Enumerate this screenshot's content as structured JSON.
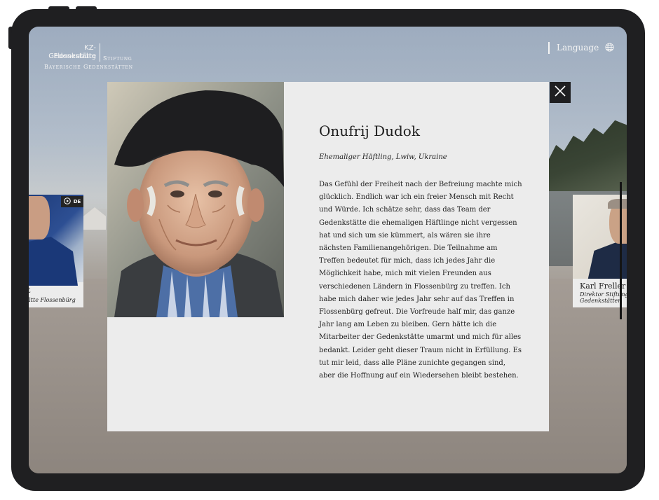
{
  "logo": {
    "line1": "KZ-Gedenkstätte",
    "line2": "Flossenbürg",
    "line3": "Stiftung",
    "line4": "Bayerische Gedenkstätten"
  },
  "header": {
    "language_label": "Language",
    "language_icon": "globe-icon"
  },
  "cards": {
    "left": {
      "badge_label": "DE",
      "play_icon": "play-icon",
      "name": "t",
      "role": "ätte Flossenbürg"
    },
    "right": {
      "name": "Karl Freller",
      "role_line1": "Direktor Stiftung",
      "role_line2": "Gedenkstätten"
    }
  },
  "modal": {
    "close_icon": "close-icon",
    "name": "Onufrij Dudok",
    "subtitle": "Ehemaliger Häftling, Lwiw, Ukraine",
    "body": "Das Gefühl der Freiheit nach der Befreiung machte mich glücklich. Endlich war ich ein freier Mensch mit Recht und Würde. Ich schätze sehr, dass das Team der Gedenkstätte die ehemaligen Häftlinge nicht vergessen hat und sich um sie kümmert, als wären sie ihre nächsten Familienangehörigen. Die Teilnahme am Treffen bedeutet für mich, dass ich jedes Jahr die Möglichkeit habe, mich mit vielen Freunden aus verschiedenen Ländern in Flossenbürg zu treffen. Ich habe mich daher wie jedes Jahr sehr auf das Treffen in Flossenbürg gefreut. Die Vorfreude half mir, das ganze Jahr lang am Leben zu bleiben. Gern hätte ich die Mitarbeiter der Gedenkstätte umarmt und mich für alles bedankt. Leider geht dieser Traum nicht in Erfüllung. Es tut mir leid, dass alle Pläne zunichte gegangen sind, aber die Hoffnung auf ein Wiedersehen bleibt bestehen."
  },
  "colors": {
    "device_frame": "#1f1f21",
    "modal_bg": "#ececec",
    "text": "#1e1e1e",
    "header_text": "#f4f4f4"
  }
}
